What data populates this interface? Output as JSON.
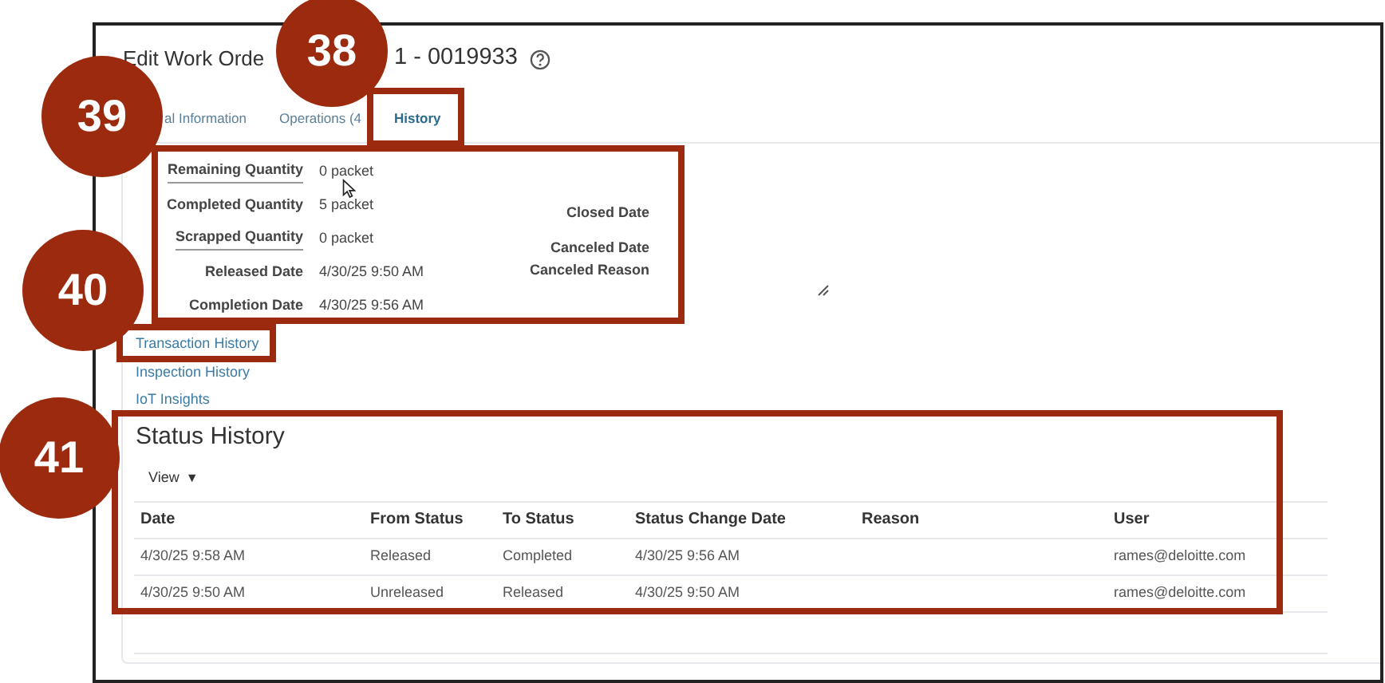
{
  "title": {
    "visible_start": "Edit Work Orde",
    "visible_end": "1 - 0019933"
  },
  "tabs": [
    {
      "label": "al Information",
      "selected": false
    },
    {
      "label": "Operations (4",
      "selected": false
    },
    {
      "label": "History",
      "selected": true
    }
  ],
  "quantities": [
    {
      "label": "Remaining Quantity",
      "value": "0 packet",
      "underlined": true
    },
    {
      "label": "Completed Quantity",
      "value": "5 packet",
      "underlined": false
    },
    {
      "label": "Scrapped Quantity",
      "value": "0 packet",
      "underlined": true
    },
    {
      "label": "Released Date",
      "value": "4/30/25 9:50 AM",
      "underlined": false
    },
    {
      "label": "Completion Date",
      "value": "4/30/25 9:56 AM",
      "underlined": false
    }
  ],
  "dates": [
    "Closed Date",
    "Canceled Date",
    "Canceled Reason"
  ],
  "links": [
    "Transaction History",
    "Inspection History",
    "IoT Insights"
  ],
  "status_history": {
    "title": "Status History",
    "view_menu": "View",
    "view_caret": "▼",
    "columns": [
      "Date",
      "From Status",
      "To Status",
      "Status Change Date",
      "Reason",
      "User"
    ],
    "rows": [
      [
        "4/30/25 9:58 AM",
        "Released",
        "Completed",
        "4/30/25 9:56 AM",
        "",
        "rames@deloitte.com"
      ],
      [
        "4/30/25 9:50 AM",
        "Unreleased",
        "Released",
        "4/30/25 9:50 AM",
        "",
        "rames@deloitte.com"
      ]
    ]
  },
  "callouts": [
    "38",
    "39",
    "40",
    "41"
  ]
}
